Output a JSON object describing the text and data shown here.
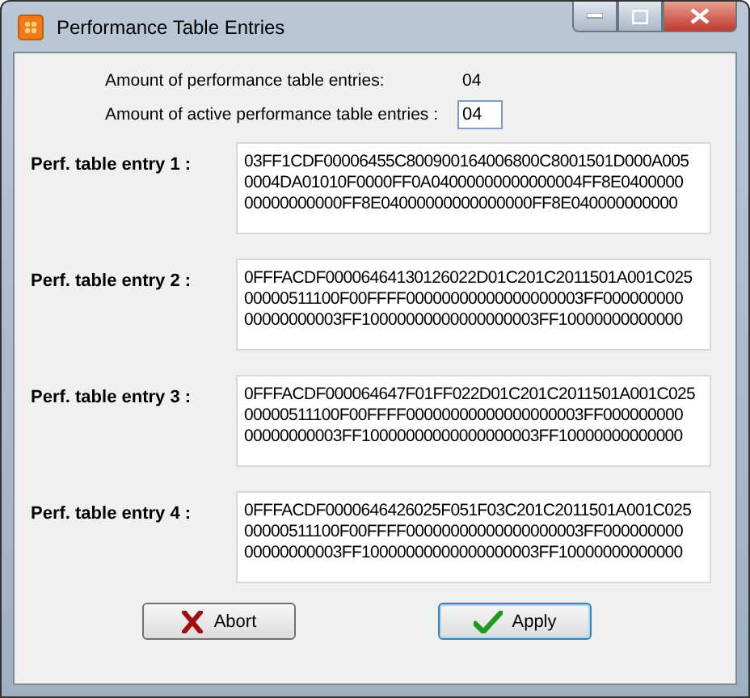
{
  "window": {
    "title": "Performance Table Entries"
  },
  "summary": {
    "total_label": "Amount of performance table entries:",
    "total_value": "04",
    "active_label": "Amount of active performance table entries :",
    "active_value": "04"
  },
  "entries": [
    {
      "label": "Perf. table entry 1 :",
      "lines": [
        "03FF1CDF00006455C800900164006800C8001501D000A005",
        "0004DA01010F0000FF0A04000000000000004FF8E0400000",
        "00000000000FF8E04000000000000000FF8E040000000000"
      ]
    },
    {
      "label": "Perf. table entry 2 :",
      "lines": [
        "0FFFACDF00006464130126022D01C201C2011501A001C025",
        "00000511100F00FFFF00000000000000000003FF000000000",
        "00000000003FF10000000000000000003FF10000000000000"
      ]
    },
    {
      "label": "Perf. table entry 3 :",
      "lines": [
        "0FFFACDF000064647F01FF022D01C201C2011501A001C025",
        "00000511100F00FFFF00000000000000000003FF000000000",
        "00000000003FF10000000000000000003FF10000000000000"
      ]
    },
    {
      "label": "Perf. table entry 4 :",
      "lines": [
        "0FFFACDF0000646426025F051F03C201C2011501A001C025",
        "00000511100F00FFFF00000000000000000003FF000000000",
        "00000000003FF10000000000000000003FF10000000000000"
      ]
    }
  ],
  "buttons": [
    {
      "label": "Abort",
      "kind": "abort",
      "default": false
    },
    {
      "label": "Apply",
      "kind": "apply",
      "default": true
    }
  ]
}
